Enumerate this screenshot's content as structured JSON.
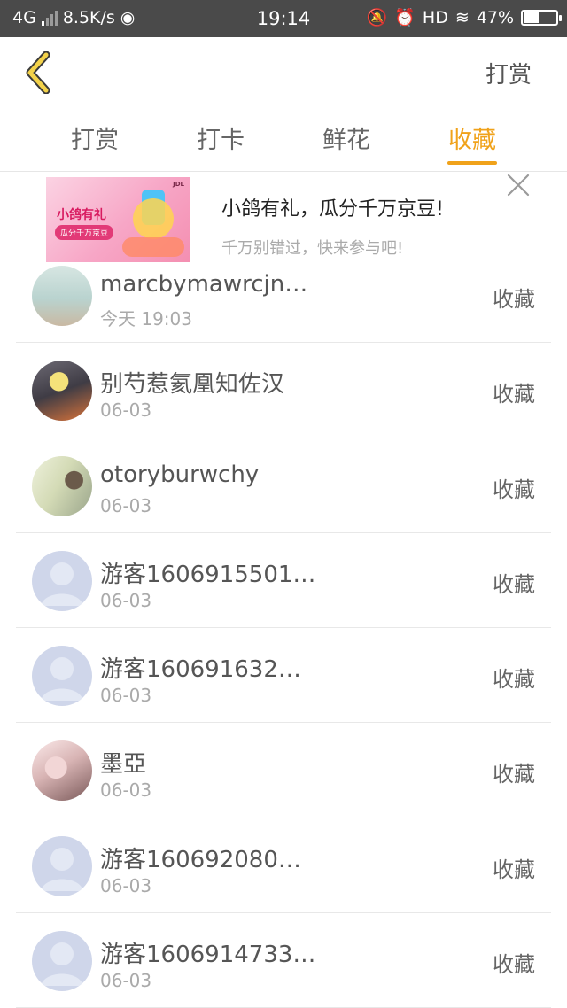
{
  "status_bar": {
    "network": "4G",
    "speed": "8.5K/s",
    "time": "19:14",
    "hd": "HD",
    "battery_percent": "47%",
    "battery_level": 0.47
  },
  "nav": {
    "back_icon": "chevron-left-icon",
    "title": "打赏"
  },
  "tabs": [
    {
      "label": "打赏",
      "active": false
    },
    {
      "label": "打卡",
      "active": false
    },
    {
      "label": "鲜花",
      "active": false
    },
    {
      "label": "收藏",
      "active": true
    }
  ],
  "ad": {
    "image_text_1": "小鸽有礼",
    "image_text_2": "瓜分千万京豆",
    "title": "小鸽有礼，瓜分千万京豆!",
    "subtitle": "千万别错过，快来参与吧!",
    "close_icon": "close-icon"
  },
  "list": [
    {
      "name": "marcbymawrcjn…",
      "date": "今天 19:03",
      "action": "收藏",
      "avatar": "photo"
    },
    {
      "name": "别芍惹氦凰知佐汉",
      "date": "06-03",
      "action": "收藏",
      "avatar": "photo"
    },
    {
      "name": "otoryburwchy",
      "date": "06-03",
      "action": "收藏",
      "avatar": "photo"
    },
    {
      "name": "游客1606915501…",
      "date": "06-03",
      "action": "收藏",
      "avatar": "guest"
    },
    {
      "name": "游客160691632…",
      "date": "06-03",
      "action": "收藏",
      "avatar": "guest"
    },
    {
      "name": "墨亞",
      "date": "06-03",
      "action": "收藏",
      "avatar": "photo"
    },
    {
      "name": "游客160692080…",
      "date": "06-03",
      "action": "收藏",
      "avatar": "guest"
    },
    {
      "name": "游客1606914733…",
      "date": "06-03",
      "action": "收藏",
      "avatar": "guest"
    }
  ],
  "colors": {
    "accent": "#f0a21a",
    "status_bar_bg": "#4a4a4a",
    "back_icon_fill": "#f3d24a",
    "guest_avatar": "#cfd6ea"
  }
}
